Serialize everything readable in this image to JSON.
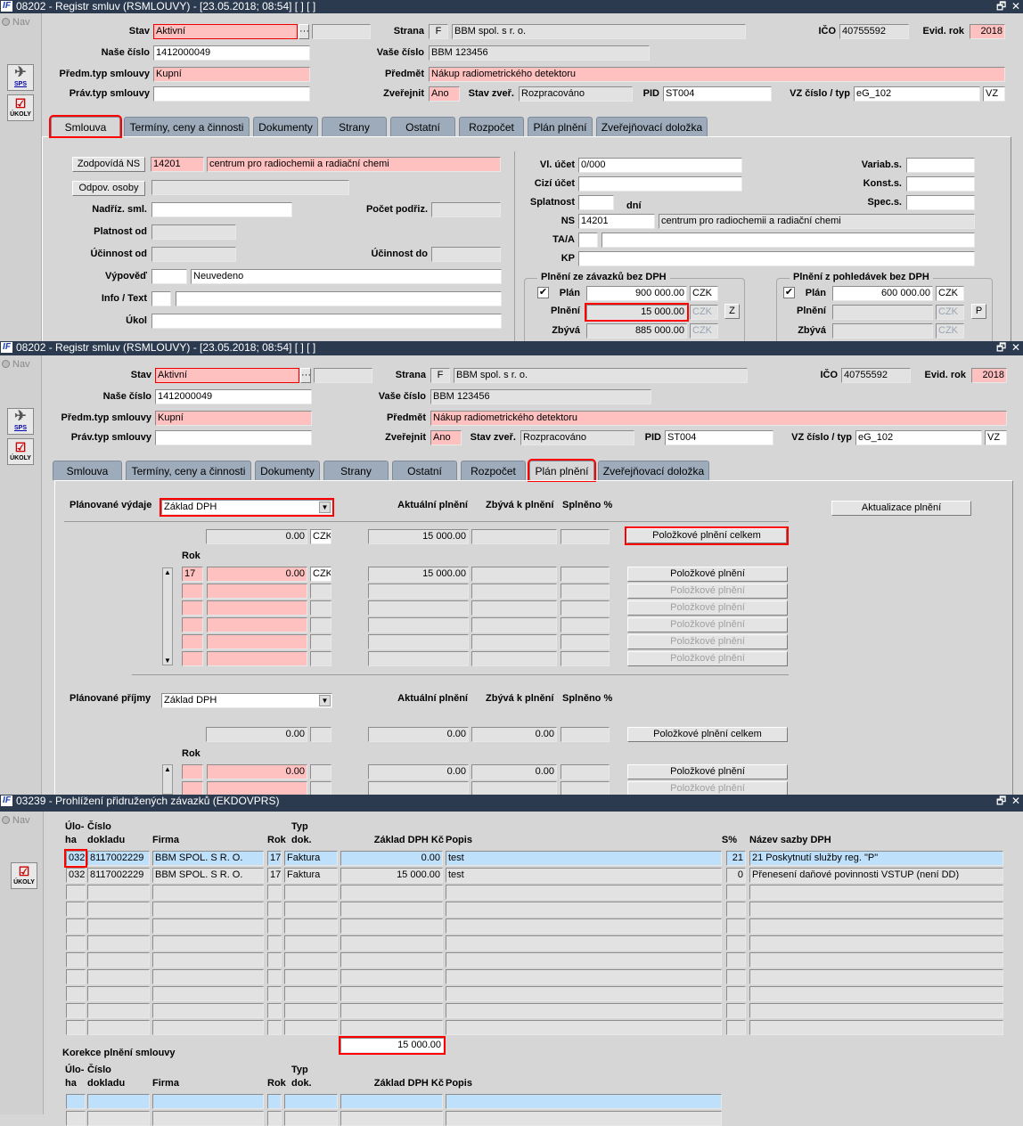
{
  "windows": {
    "w1_title": "08202 - Registr smluv (RSMLOUVY) - [23.05.2018; 08:54]  [ ]  [ ]",
    "w2_title": "08202 - Registr smluv (RSMLOUVY) - [23.05.2018; 08:54]  [ ]  [ ]",
    "w3_title": "03239 - Prohlížení přidružených závazků (EKDOVPRS)",
    "logo": "IF",
    "restore": "🗗",
    "close": "✕",
    "nav": "Nav",
    "sps": "SPS",
    "ukoly": "ÚKOLY"
  },
  "header": {
    "stav_label": "Stav",
    "stav": "Aktivní",
    "dots": "···",
    "strana_label": "Strana",
    "strana_code": "F",
    "strana_name": "BBM spol. s r. o.",
    "ico_label": "IČO",
    "ico": "40755592",
    "evid_label": "Evid. rok",
    "evid_rok": "2018",
    "nase_label": "Naše číslo",
    "nase": "1412000049",
    "vase_label": "Vaše číslo",
    "vase": "BBM 123456",
    "predm_typ_label": "Předm.typ smlouvy",
    "predm_typ": "Kupní",
    "predmet_label": "Předmět",
    "predmet": "Nákup radiometrického detektoru",
    "prav_label": "Práv.typ smlouvy",
    "zverejnit_label": "Zveřejnit",
    "zverejnit": "Ano",
    "stav_zver_label": "Stav zveř.",
    "stav_zver": "Rozpracováno",
    "pid_label": "PID",
    "pid": "ST004",
    "vz_label": "VZ číslo / typ",
    "vz_cislo": "eG_102",
    "vz_typ": "VZ"
  },
  "tabs": [
    "Smlouva",
    "Termíny, ceny a činnosti",
    "Dokumenty",
    "Strany",
    "Ostatní",
    "Rozpočet",
    "Plán plnění",
    "Zveřejňovací doložka"
  ],
  "smlouva": {
    "zodp_ns_btn": "Zodpovídá NS",
    "zodp_ns": "14201",
    "zodp_ns_name": "centrum pro radiochemii a radiační chemi",
    "odpov_btn": "Odpov. osoby",
    "nadriz_label": "Nadříz. sml.",
    "pocet_label": "Počet podřiz.",
    "platnost_label": "Platnost od",
    "ucinnost_od_label": "Účinnost od",
    "ucinnost_do_label": "Účinnost do",
    "vypoved_label": "Výpověď",
    "vypoved": "Neuvedeno",
    "info_label": "Info / Text",
    "ukol_label": "Úkol",
    "vl_ucet_label": "Vl. účet",
    "vl_ucet": "0/000",
    "cizi_label": "Cizí účet",
    "splatnost_label": "Splatnost",
    "dni": "dní",
    "ns_label": "NS",
    "ns": "14201",
    "ns_name": "centrum pro radiochemii a radiační chemi",
    "taa_label": "TA/A",
    "kp_label": "KP",
    "variab_label": "Variab.s.",
    "konst_label": "Konst.s.",
    "spec_label": "Spec.s.",
    "zav": {
      "title": "Plnění ze závazků bez DPH",
      "plan_label": "Plán",
      "plan": "900 000.00",
      "plneni_label": "Plnění",
      "plneni": "15 000.00",
      "zbyva_label": "Zbývá",
      "zbyva": "885 000.00",
      "cur": "CZK",
      "btn": "Z",
      "check": "✔"
    },
    "pohl": {
      "title": "Plnění z pohledávek bez DPH",
      "plan_label": "Plán",
      "plan": "600 000.00",
      "plneni_label": "Plnění",
      "zbyva_label": "Zbývá",
      "cur": "CZK",
      "btn": "P",
      "check": "✔"
    }
  },
  "plan": {
    "vydaje_label": "Plánované výdaje",
    "vydaje_select": "Základ DPH",
    "prijmy_label": "Plánované příjmy",
    "prijmy_select": "Základ DPH",
    "col_aktualni": "Aktuální plnění",
    "col_zbyva": "Zbývá k plnění",
    "col_splneno": "Splněno %",
    "aktualizace_btn": "Aktualizace plnění",
    "celkem_btn": "Položkové plnění celkem",
    "polozkove_btn": "Položkové plnění",
    "rok_label": "Rok",
    "cur": "CZK",
    "vydaje_total": {
      "plan": "0.00",
      "aktualni": "15 000.00"
    },
    "vydaje_row": {
      "rok": "17",
      "plan": "0.00",
      "aktualni": "15 000.00"
    },
    "prijmy_total": {
      "plan": "0.00",
      "aktualni": "0.00",
      "zbyva": "0.00"
    },
    "prijmy_row": {
      "plan": "0.00",
      "aktualni": "0.00",
      "zbyva": "0.00"
    }
  },
  "zavazky": {
    "h_uloha1": "Úlo-",
    "h_uloha2": "ha",
    "h_cislo1": "Číslo",
    "h_cislo2": "dokladu",
    "h_firma": "Firma",
    "h_rok": "Rok",
    "h_typ1": "Typ",
    "h_typ2": "dok.",
    "h_zaklad": "Základ DPH Kč",
    "h_popis": "Popis",
    "h_s": "S%",
    "h_nazev": "Název sazby DPH",
    "rows": [
      [
        "032",
        "8117002229",
        "BBM SPOL. S R. O.",
        "17",
        "Faktura",
        "0.00",
        "test",
        "21",
        "21  Poskytnutí služby reg. \"P\""
      ],
      [
        "032",
        "8117002229",
        "BBM SPOL. S R. O.",
        "17",
        "Faktura",
        "15 000.00",
        "test",
        "0",
        "Přenesení daňové povinnosti VSTUP (není DD)"
      ]
    ],
    "sum": "15 000.00",
    "korekce_title": "Korekce plnění smlouvy"
  }
}
